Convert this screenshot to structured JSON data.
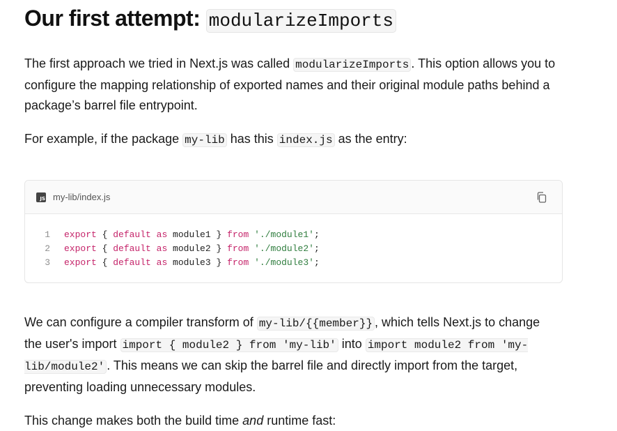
{
  "heading": {
    "prefix": "Our first attempt: ",
    "code": "modularizeImports"
  },
  "para1": {
    "t1": "The first approach we tried in Next.js was called ",
    "code": "modularizeImports",
    "t2": ". This option allows you to configure the mapping relationship of exported names and their original module paths behind a package’s barrel file entrypoint."
  },
  "para2": {
    "t1": "For example, if the package ",
    "code1": "my-lib",
    "t2": " has this ",
    "code2": "index.js",
    "t3": " as the entry:"
  },
  "codeblock": {
    "lang_icon": "JS",
    "filename": "my-lib/index.js",
    "copy_icon": "copy-icon",
    "lines": [
      {
        "num": "1",
        "kw1": "export",
        "p1": " { ",
        "kw2": "default",
        "sp1": " ",
        "kw3": "as",
        "p2": " module1 } ",
        "kw4": "from",
        "sp2": " ",
        "str": "'./module1'",
        "end": ";"
      },
      {
        "num": "2",
        "kw1": "export",
        "p1": " { ",
        "kw2": "default",
        "sp1": " ",
        "kw3": "as",
        "p2": " module2 } ",
        "kw4": "from",
        "sp2": " ",
        "str": "'./module2'",
        "end": ";"
      },
      {
        "num": "3",
        "kw1": "export",
        "p1": " { ",
        "kw2": "default",
        "sp1": " ",
        "kw3": "as",
        "p2": " module3 } ",
        "kw4": "from",
        "sp2": " ",
        "str": "'./module3'",
        "end": ";"
      }
    ]
  },
  "para3": {
    "t1": "We can configure a compiler transform of ",
    "code1": "my-lib/{{member}}",
    "t2": ", which tells Next.js to change the user's import ",
    "code2": "import { module2 } from 'my-lib'",
    "t3": " into ",
    "code3": "import module2 from 'my-lib/module2'",
    "t4": ". This means we can skip the barrel file and directly import from the target, preventing loading unnecessary modules."
  },
  "para4": {
    "t1": "This change makes both the build time ",
    "em": "and",
    "t2": " runtime fast:"
  }
}
